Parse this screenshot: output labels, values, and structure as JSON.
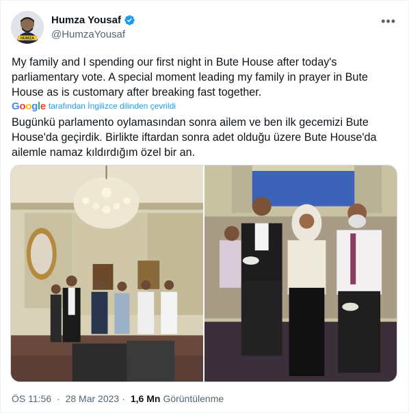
{
  "author": {
    "name": "Humza Yousaf",
    "handle": "@HumzaYousaf",
    "verified": true,
    "avatar_badge": "HUMZA"
  },
  "tweet": {
    "text": "My family and I spending our first night in Bute House after today's parliamentary vote. A special moment leading my family in prayer in Bute House as is customary after breaking fast together.",
    "translation_note": "tarafından İngilizce dilinden çevrildi",
    "translation_provider": "Google",
    "translated_text": "Bugünkü parlamento oylamasından sonra ailem ve ben ilk gecemizi Bute House'da geçirdik. Birlikte iftardan sonra adet olduğu üzere Bute House'da ailemle namaz kıldırdığım özel bir an."
  },
  "meta": {
    "time": "ÖS 11:56",
    "date": "28 Mar 2023",
    "views_count": "1,6 Mn",
    "views_label": "Görüntülenme"
  },
  "icons": {
    "verified": "verified-badge-icon",
    "more": "more-options-icon"
  },
  "colors": {
    "accent": "#1d9bf0",
    "secondary_text": "#536471",
    "primary_text": "#0f1419"
  }
}
